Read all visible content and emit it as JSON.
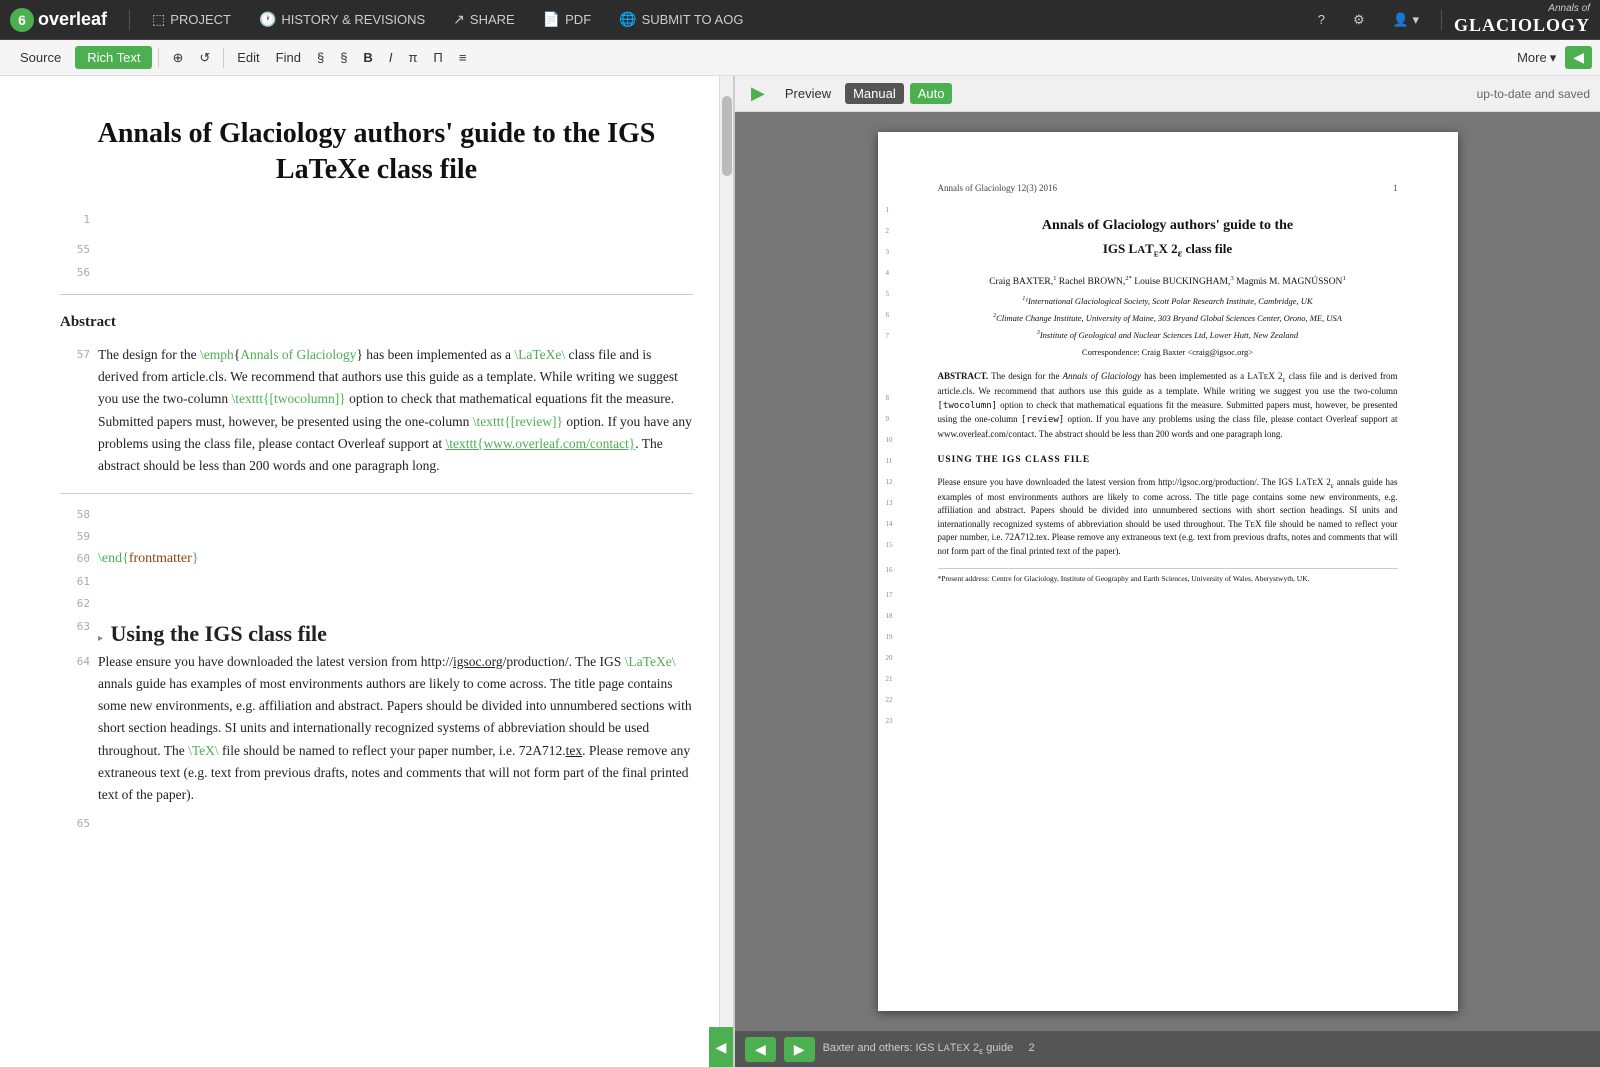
{
  "app": {
    "logo_letter": "6",
    "logo_text": "overleaf"
  },
  "nav": {
    "project_label": "PROJECT",
    "history_label": "HISTORY & REVISIONS",
    "share_label": "SHARE",
    "pdf_label": "PDF",
    "submit_label": "SUBMIT TO AOG",
    "help_icon": "?",
    "settings_icon": "⚙",
    "user_icon": "👤",
    "journal_name": "Annals of",
    "journal_name2": "GLACIOLOGY"
  },
  "toolbar": {
    "source_label": "Source",
    "rich_text_label": "Rich Text",
    "insert_icon": "⊕",
    "history_icon": "↺",
    "edit_label": "Edit",
    "find_label": "Find",
    "section_icon": "§",
    "section2_icon": "§",
    "bold_icon": "B",
    "italic_icon": "I",
    "pi_icon": "π",
    "pi2_icon": "Π",
    "list_icon": "≡",
    "more_label": "More",
    "collapse_icon": "◀"
  },
  "preview": {
    "play_icon": "▶",
    "preview_label": "Preview",
    "manual_label": "Manual",
    "auto_label": "Auto",
    "status": "up-to-date and saved",
    "prev_icon": "◀",
    "next_icon": "▶"
  },
  "editor": {
    "doc_title": "Annals of Glaciology authors' guide to the IGS LaTeXe class file",
    "line_numbers": [
      "1",
      "55",
      "56",
      "57",
      "58",
      "59",
      "60",
      "61",
      "62",
      "63",
      "64",
      "65"
    ],
    "abstract_title": "Abstract",
    "abstract_text": "The design for the \\emph{Annals of Glaciology} has been implemented as a \\LaTeXe\\ class file and is derived from article.cls. We recommend that authors use this guide as a template. While writing we suggest you use the two-column \\texttt{[twocolumn]} option to check that mathematical equations fit the measure. Submitted papers must, however, be presented using the one-column \\texttt{[review]} option. If you have any problems using the class file, please contact Overleaf support at \\texttt{www.overleaf.com/contact}. The abstract should be less than 200 words and one paragraph long.",
    "end_command": "\\end{frontmatter}",
    "section2_title": "Using the IGS class file",
    "section2_text": "Please ensure you have downloaded the latest version from http://igsoc.org/production/. The IGS \\LaTeXe\\ annals guide has examples of most environments authors are likely to come across. The title page contains some new environments, e.g. affiliation and abstract. Papers should be divided into unnumbered sections with short section headings. SI units and internationally recognized systems of abbreviation should be used throughout. The \\TeX\\ file should be named to reflect your paper number, i.e. 72A712.tex. Please remove any extraneous text (e.g. text from previous drafts, notes and comments that will not form part of the final printed text of the paper)."
  },
  "pdf": {
    "header_left": "Annals of Glaciology 12(3) 2016",
    "header_right": "1",
    "title_line1": "Annals of Glaciology authors' guide to the",
    "title_line2": "IGS LATEX 2ε class file",
    "authors": "Craig BAXTER,¹ Rachel BROWN,²* Louise BUCKINGHAM,³ Magnús M. MAGNÚSSON¹",
    "affiliation1": "¹International Glaciological Society, Scott Polar Research Institute, Cambridge, UK",
    "affiliation2": "²Climate Change Institute, University of Maine, 303 Bryand Global Sciences Center, Orono, ME, USA",
    "affiliation3": "³Institute of Geological and Nuclear Sciences Ltd, Lower Hutt, New Zealand",
    "correspondence": "Correspondence: Craig Baxter <craig@igsoc.org>",
    "abstract_label": "ABSTRACT.",
    "abstract_body": "The design for the Annals of Glaciology has been implemented as a LATEX 2ε class file and is derived from article.cls. We recommend that authors use this guide as a template. While writing we suggest you use the two-column [twocolumn] option to check that mathematical equations fit the measure. Submitted papers must, however, be presented using the one-column [review] option. If you have any problems using the class file, please contact Overleaf support at www.overleaf.com/contact. The abstract should be less than 200 words and one paragraph long.",
    "section_heading": "USING THE IGS CLASS FILE",
    "section_body": "Please ensure you have downloaded the latest version from http://igsoc.org/production/. The IGS LATEX 2ε annals guide has examples of most environments authors are likely to come across. The title page contains some new environments, e.g. affiliation and abstract. Papers should be divided into unnumbered sections with short section headings. SI units and internationally recognized systems of abbreviation should be used throughout. The TEX file should be named to reflect your paper number, i.e. 72A712.tex. Please remove any extraneous text (e.g. text from previous drafts, notes and comments that will not form part of the final printed text of the paper).",
    "footnote": "*Present address: Centre for Glaciology, Institute of Geography and Earth Sciences, University of Wales, Aberystwyth, UK.",
    "footer_left": "Baxter and others: IGS LATEX 2ε guide",
    "footer_right": "2",
    "line_numbers": [
      "1",
      "2",
      "3",
      "4",
      "5",
      "6",
      "7",
      "8",
      "9",
      "10",
      "11",
      "12",
      "13",
      "14",
      "15",
      "16",
      "17",
      "18",
      "19",
      "20",
      "21",
      "22",
      "23"
    ]
  }
}
